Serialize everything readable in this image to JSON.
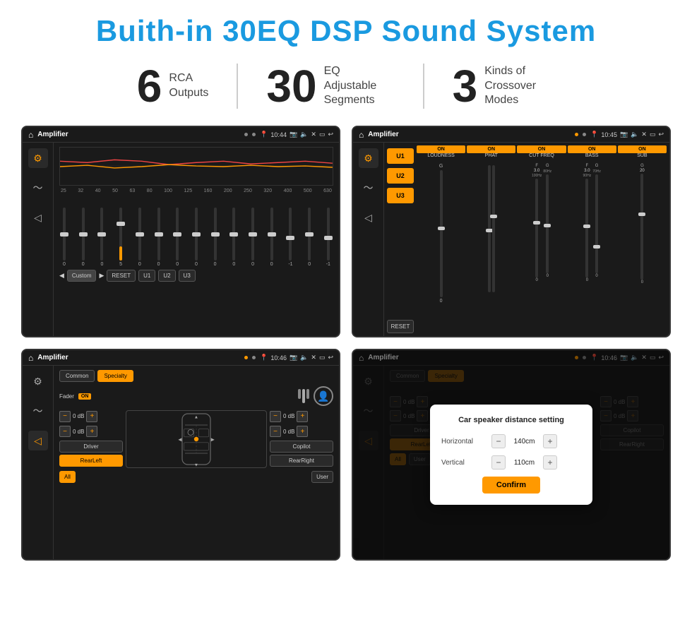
{
  "page": {
    "title": "Buith-in 30EQ DSP Sound System",
    "stats": [
      {
        "number": "6",
        "label_line1": "RCA",
        "label_line2": "Outputs"
      },
      {
        "number": "30",
        "label_line1": "EQ Adjustable",
        "label_line2": "Segments"
      },
      {
        "number": "3",
        "label_line1": "Kinds of",
        "label_line2": "Crossover Modes"
      }
    ]
  },
  "screens": {
    "eq": {
      "title": "Amplifier",
      "time": "10:44",
      "labels": [
        "25",
        "32",
        "40",
        "50",
        "63",
        "80",
        "100",
        "125",
        "160",
        "200",
        "250",
        "320",
        "400",
        "500",
        "630"
      ],
      "values": [
        "0",
        "0",
        "0",
        "5",
        "0",
        "0",
        "0",
        "0",
        "0",
        "0",
        "0",
        "0",
        "-1",
        "0",
        "-1"
      ],
      "bottom_buttons": [
        "Custom",
        "RESET",
        "U1",
        "U2",
        "U3"
      ]
    },
    "crossover": {
      "title": "Amplifier",
      "time": "10:45",
      "channels": [
        "LOUDNESS",
        "PHAT",
        "CUT FREQ",
        "BASS",
        "SUB"
      ],
      "u_buttons": [
        "U1",
        "U2",
        "U3"
      ],
      "reset_label": "RESET"
    },
    "speaker_setup": {
      "title": "Amplifier",
      "time": "10:46",
      "tabs": [
        "Common",
        "Specialty"
      ],
      "fader_label": "Fader",
      "fader_on": "ON",
      "controls": {
        "top_left_db": "0 dB",
        "mid_left_db": "0 dB",
        "top_right_db": "0 dB",
        "mid_right_db": "0 dB"
      },
      "bottom_buttons": [
        "Driver",
        "RearLeft",
        "All",
        "User",
        "RearRight",
        "Copilot"
      ]
    },
    "speaker_distance": {
      "title": "Amplifier",
      "time": "10:46",
      "dialog_title": "Car speaker distance setting",
      "horizontal_label": "Horizontal",
      "horizontal_value": "140cm",
      "vertical_label": "Vertical",
      "vertical_value": "110cm",
      "confirm_label": "Confirm",
      "tabs": [
        "Common",
        "Specialty"
      ],
      "bottom_buttons": [
        "Driver",
        "RearLeft",
        "All",
        "User",
        "RearRight",
        "Copilot"
      ]
    }
  }
}
